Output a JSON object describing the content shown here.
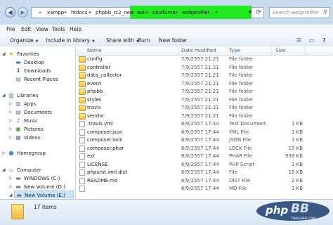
{
  "search": {
    "placeholder": "Search webprofiler"
  },
  "breadcrumb": [
    "«",
    "xampp",
    "htdocs",
    "phpbb_rc2_new",
    "ext",
    "nicofuma",
    "webprofiler"
  ],
  "menu": [
    "File",
    "Edit",
    "View",
    "Tools",
    "Help"
  ],
  "toolbar": {
    "organize": "Organize",
    "include": "Include in library",
    "share": "Share with",
    "burn": "Burn",
    "new_folder": "New folder"
  },
  "nav": {
    "favorites": "Favorites",
    "desktop": "Desktop",
    "downloads": "Downloads",
    "recent": "Recent Places",
    "libraries": "Libraries",
    "apps": "Apps",
    "documents": "Documents",
    "music": "Music",
    "pictures": "Pictures",
    "videos": "Videos",
    "homegroup": "Homegroup",
    "computer": "Computer",
    "windows": "WINDOWS (C:)",
    "vol_d": "New Volume (D:)",
    "vol_e": "New Volume (E:)"
  },
  "columns": {
    "name": "Name",
    "date": "Date modified",
    "type": "Type",
    "size": "Size"
  },
  "files": [
    {
      "name": "config",
      "date": "7/9/2557 21:21",
      "type": "File folder",
      "size": "",
      "kind": "folder"
    },
    {
      "name": "controller",
      "date": "7/9/2557 21:21",
      "type": "File folder",
      "size": "",
      "kind": "folder"
    },
    {
      "name": "data_collector",
      "date": "7/9/2557 21:21",
      "type": "File folder",
      "size": "",
      "kind": "folder"
    },
    {
      "name": "event",
      "date": "7/9/2557 21:21",
      "type": "File folder",
      "size": "",
      "kind": "folder"
    },
    {
      "name": "phpbb",
      "date": "7/9/2557 21:21",
      "type": "File folder",
      "size": "",
      "kind": "folder"
    },
    {
      "name": "styles",
      "date": "7/9/2557 21:21",
      "type": "File folder",
      "size": "",
      "kind": "folder"
    },
    {
      "name": "travis",
      "date": "7/9/2557 21:21",
      "type": "File folder",
      "size": "",
      "kind": "folder"
    },
    {
      "name": "vendor",
      "date": "7/9/2557 21:21",
      "type": "File folder",
      "size": "",
      "kind": "folder"
    },
    {
      "name": ".travis.yml",
      "date": "6/9/2557 17:44",
      "type": "Text Document",
      "size": "1 KB",
      "kind": "file"
    },
    {
      "name": "composer.json",
      "date": "6/9/2557 17:44",
      "type": "YML File",
      "size": "1 KB",
      "kind": "file"
    },
    {
      "name": "composer.lock",
      "date": "6/9/2557 17:44",
      "type": "JSON File",
      "size": "1 KB",
      "kind": "file"
    },
    {
      "name": "composer.phar",
      "date": "6/9/2557 17:44",
      "type": "LOCK File",
      "size": "15 KB",
      "kind": "file"
    },
    {
      "name": "ext",
      "date": "6/9/2557 17:44",
      "type": "PHAR File",
      "size": "938 KB",
      "kind": "file"
    },
    {
      "name": "LICENSE",
      "date": "6/9/2557 17:44",
      "type": "PHP Script",
      "size": "1 KB",
      "kind": "file"
    },
    {
      "name": "phpunit.xml.dist",
      "date": "6/9/2557 17:44",
      "type": "File",
      "size": "18 KB",
      "kind": "file"
    },
    {
      "name": "README.md",
      "date": "6/9/2557 17:44",
      "type": "DIST File",
      "size": "2 KB",
      "kind": "file"
    },
    {
      "name": "",
      "date": "6/9/2557 17:44",
      "type": "MD File",
      "size": "1 KB",
      "kind": "file"
    }
  ],
  "status": {
    "count": "17 items"
  },
  "watermark": "php BB THAILAND.COM",
  "colors": {
    "highlight": "#22e822",
    "selection": "#cce4f7"
  }
}
